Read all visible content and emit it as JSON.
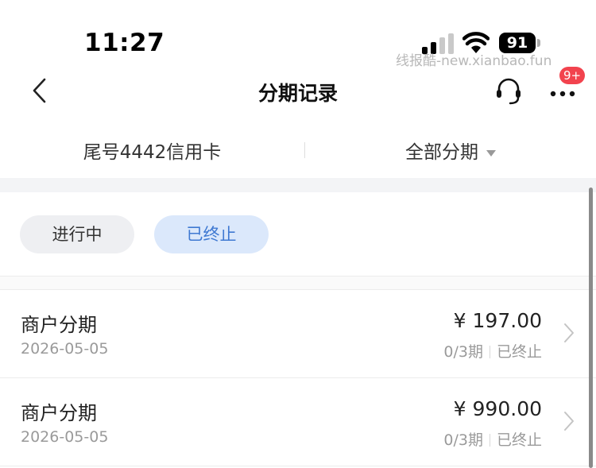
{
  "status_bar": {
    "time": "11:27",
    "battery": "91",
    "watermark": "线报酷-new.xianbao.fun"
  },
  "nav": {
    "title": "分期记录",
    "badge": "9+"
  },
  "filters": {
    "card": "尾号4442信用卡",
    "type": "全部分期"
  },
  "tabs": [
    {
      "label": "进行中",
      "selected": false
    },
    {
      "label": "已终止",
      "selected": true
    }
  ],
  "records": [
    {
      "title": "商户分期",
      "date": "2026-05-05",
      "amount": "¥ 197.00",
      "periods": "0/3期",
      "status": "已终止"
    },
    {
      "title": "商户分期",
      "date": "2026-05-05",
      "amount": "¥ 990.00",
      "periods": "0/3期",
      "status": "已终止"
    }
  ],
  "colors": {
    "accent": "#3f79d2",
    "active_tab_bg": "#dbe8fb",
    "badge": "#f2434e"
  },
  "icons": [
    "signal-icon",
    "wifi-icon",
    "battery-icon",
    "back-icon",
    "headset-icon",
    "more-icon",
    "caret-down-icon",
    "chevron-right-icon"
  ]
}
